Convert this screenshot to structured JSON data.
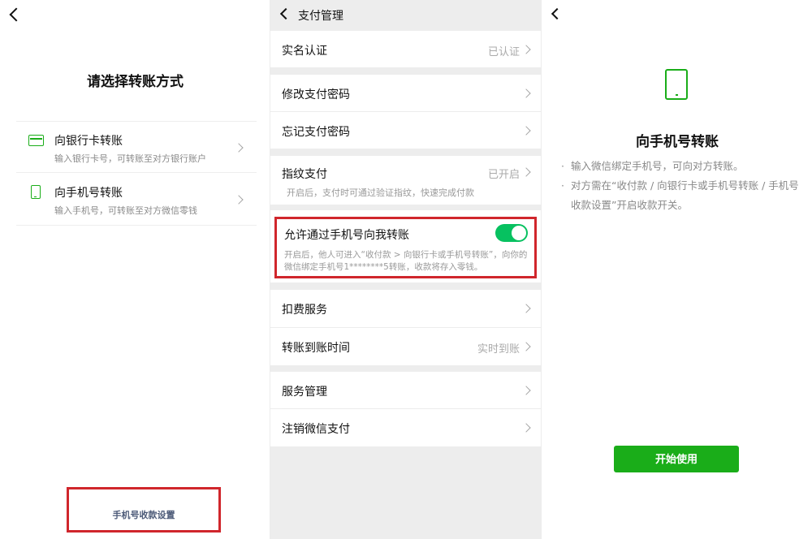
{
  "left": {
    "title": "请选择转账方式",
    "options": [
      {
        "title": "向银行卡转账",
        "desc": "输入银行卡号，可转账至对方银行账户",
        "icon": "bank-card-icon"
      },
      {
        "title": "向手机号转账",
        "desc": "输入手机号，可转账至对方微信零钱",
        "icon": "phone-icon"
      }
    ],
    "bottom_link": "手机号收款设置"
  },
  "middle": {
    "title": "支付管理",
    "rows": [
      {
        "label": "实名认证",
        "value": "已认证"
      },
      {
        "label": "修改支付密码",
        "value": ""
      },
      {
        "label": "忘记支付密码",
        "value": ""
      },
      {
        "label": "指纹支付",
        "value": "已开启",
        "desc": "开启后，支付时可通过验证指纹，快速完成付款"
      },
      {
        "label": "扣费服务",
        "value": ""
      },
      {
        "label": "转账到账时间",
        "value": "实时到账"
      },
      {
        "label": "服务管理",
        "value": ""
      },
      {
        "label": "注销微信支付",
        "value": ""
      }
    ],
    "toggle": {
      "label": "允许通过手机号向我转账",
      "enabled": true,
      "desc": "开启后，他人可进入“收付款 > 向银行卡或手机号转账”，向你的微信绑定手机号1********5转账，收款将存入零钱。"
    }
  },
  "right": {
    "title": "向手机号转账",
    "points": [
      "输入微信绑定手机号，可向对方转账。",
      "对方需在“收付款 / 向银行卡或手机号转账 / 手机号收款设置”开启收款开关。"
    ],
    "button": "开始使用"
  },
  "colors": {
    "accent_green": "#1aad19",
    "switch_green": "#07c160",
    "highlight_red": "#d0262c",
    "page_grey": "#ededed"
  }
}
